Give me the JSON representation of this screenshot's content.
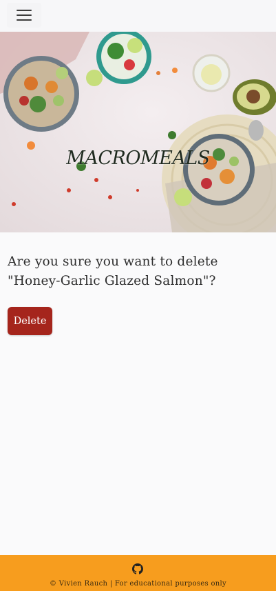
{
  "navbar": {
    "menu_icon": "hamburger-menu-icon"
  },
  "hero": {
    "title": "MACROMEALS"
  },
  "main": {
    "confirm_text": "Are you sure you want to delete \"Honey-Garlic Glazed Salmon\"?",
    "delete_label": "Delete",
    "delete_color": "#a5251c"
  },
  "footer": {
    "github_icon": "github-icon",
    "text": "© Vivien Rauch | For educational purposes only",
    "background": "#f79d1e"
  }
}
